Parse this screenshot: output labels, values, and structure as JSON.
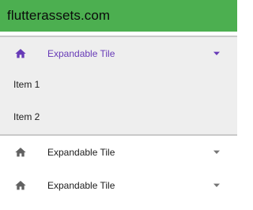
{
  "app_bar": {
    "title": "flutterassets.com",
    "background": "#4caf50"
  },
  "tiles": [
    {
      "label": "Expandable Tile",
      "expanded": true,
      "leading_icon": "home-icon",
      "trailing_icon": "arrow-drop-down-icon",
      "children": [
        {
          "label": "Item 1"
        },
        {
          "label": "Item 2"
        }
      ]
    },
    {
      "label": "Expandable Tile",
      "expanded": false,
      "leading_icon": "home-icon",
      "trailing_icon": "arrow-drop-down-icon"
    },
    {
      "label": "Expandable Tile",
      "expanded": false,
      "leading_icon": "home-icon",
      "trailing_icon": "arrow-drop-down-icon"
    }
  ],
  "colors": {
    "active": "#673ab7",
    "expanded_background": "#eeeeee",
    "text": "#1c1c1c",
    "icon": "#616161"
  }
}
